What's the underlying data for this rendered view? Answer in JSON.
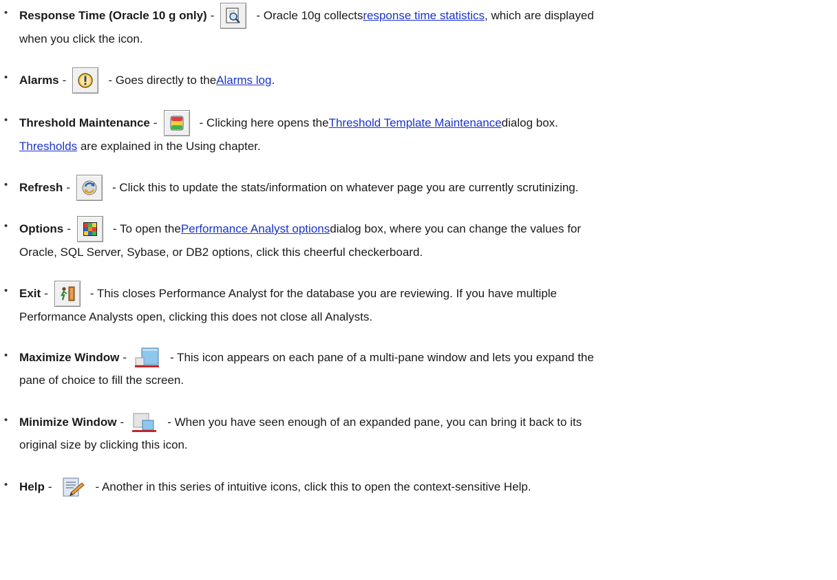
{
  "items": [
    {
      "term": "Response Time (Oracle 10 g only)",
      "icon": "response-time-icon",
      "text_before": "- Oracle 10g collects ",
      "link": "response time statistics",
      "text_after": ", which are displayed",
      "line2": "when you click the icon."
    },
    {
      "term": "Alarms",
      "icon": "alarms-icon",
      "text_before": "- Goes directly to the ",
      "link": "Alarms log",
      "text_after": "."
    },
    {
      "term": "Threshold Maintenance",
      "icon": "threshold-maintenance-icon",
      "text_before": "- Clicking here opens the ",
      "link": "Threshold Template Maintenance",
      "text_after": " dialog box.",
      "line2_link": "Thresholds",
      "line2_after": " are explained in the Using chapter."
    },
    {
      "term": "Refresh",
      "icon": "refresh-icon",
      "text_before": "- Click this to update the stats/information on whatever page you are currently scrutinizing."
    },
    {
      "term": "Options",
      "icon": "options-checkerboard-icon",
      "text_before": "- To open the",
      "link": " Performance Analyst options",
      "text_after": " dialog box, where you can change the values for",
      "line2": "Oracle, SQL Server, Sybase, or DB2 options, click this cheerful checkerboard."
    },
    {
      "term": "Exit",
      "icon": "exit-icon",
      "text_before": "- This closes Performance Analyst for the database you are reviewing. If you have multiple",
      "line2": "Performance Analysts open, clicking this does not close all Analysts."
    },
    {
      "term": "Maximize Window",
      "icon": "maximize-window-icon",
      "text_before": "- This icon appears on each pane of a multi-pane window and lets you expand the",
      "line2": "pane of choice to fill the screen."
    },
    {
      "term": "Minimize Window",
      "icon": "minimize-window-icon",
      "text_before": "- When you have seen enough of an expanded pane, you can bring it back to its",
      "line2": "original size by clicking this icon."
    },
    {
      "term": "Help",
      "icon": "help-icon",
      "text_before": "- Another in this series of intuitive icons, click this to open the context-sensitive Help."
    }
  ],
  "bullet": "•",
  "separator": "-",
  "colors": {
    "link": "#1a33cc",
    "text": "#1a1a1a"
  }
}
